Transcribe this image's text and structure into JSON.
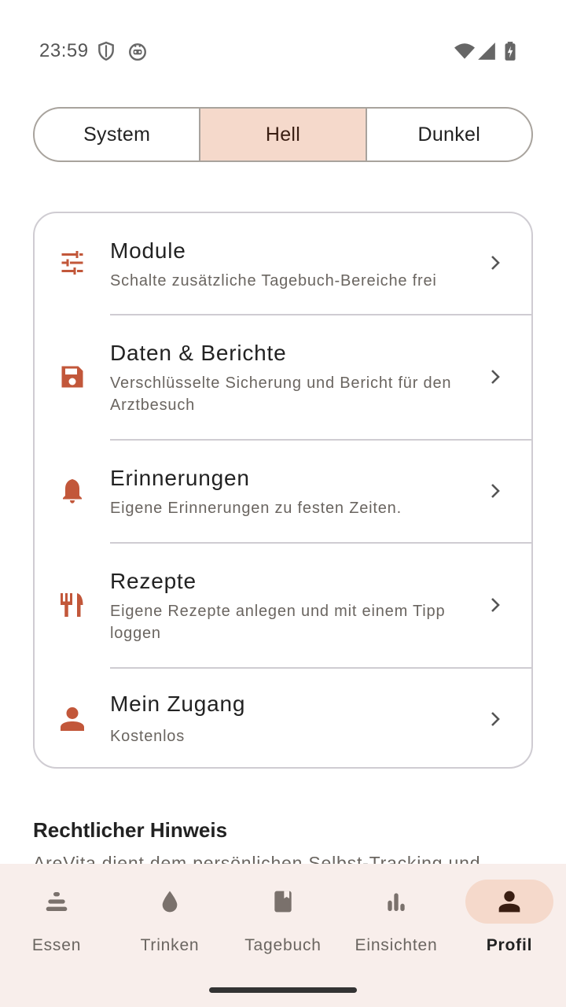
{
  "status_bar": {
    "time": "23:59",
    "icons": [
      "shield-icon",
      "robot-icon",
      "wifi-icon",
      "signal-icon",
      "battery-charging-icon"
    ]
  },
  "theme_selector": {
    "options": [
      "System",
      "Hell",
      "Dunkel"
    ],
    "selected": "Hell"
  },
  "settings": {
    "items": [
      {
        "icon": "tune-icon",
        "title": "Module",
        "subtitle": "Schalte zusätzliche Tagebuch-Bereiche frei"
      },
      {
        "icon": "save-icon",
        "title": "Daten & Berichte",
        "subtitle": "Verschlüsselte Sicherung und Bericht für den Arztbesuch"
      },
      {
        "icon": "bell-icon",
        "title": "Erinnerungen",
        "subtitle": "Eigene Erinnerungen zu festen Zeiten."
      },
      {
        "icon": "restaurant-icon",
        "title": "Rezepte",
        "subtitle": "Eigene Rezepte anlegen und mit einem Tipp loggen"
      },
      {
        "icon": "person-icon",
        "title": "Mein Zugang",
        "subtitle": "Kostenlos"
      }
    ]
  },
  "legal": {
    "title": "Rechtlicher Hinweis",
    "text": "AreVita dient dem persönlichen Selbst-Tracking und"
  },
  "bottom_nav": {
    "items": [
      {
        "icon": "food-stack-icon",
        "label": "Essen"
      },
      {
        "icon": "water-drop-icon",
        "label": "Trinken"
      },
      {
        "icon": "diary-icon",
        "label": "Tagebuch"
      },
      {
        "icon": "bar-chart-icon",
        "label": "Einsichten"
      },
      {
        "icon": "person-icon",
        "label": "Profil"
      }
    ],
    "active": "Profil"
  },
  "colors": {
    "accent": "#c2573a",
    "selected_bg": "#f5d9cb",
    "nav_bg": "#f8eeeb",
    "border": "#a8a39d"
  }
}
